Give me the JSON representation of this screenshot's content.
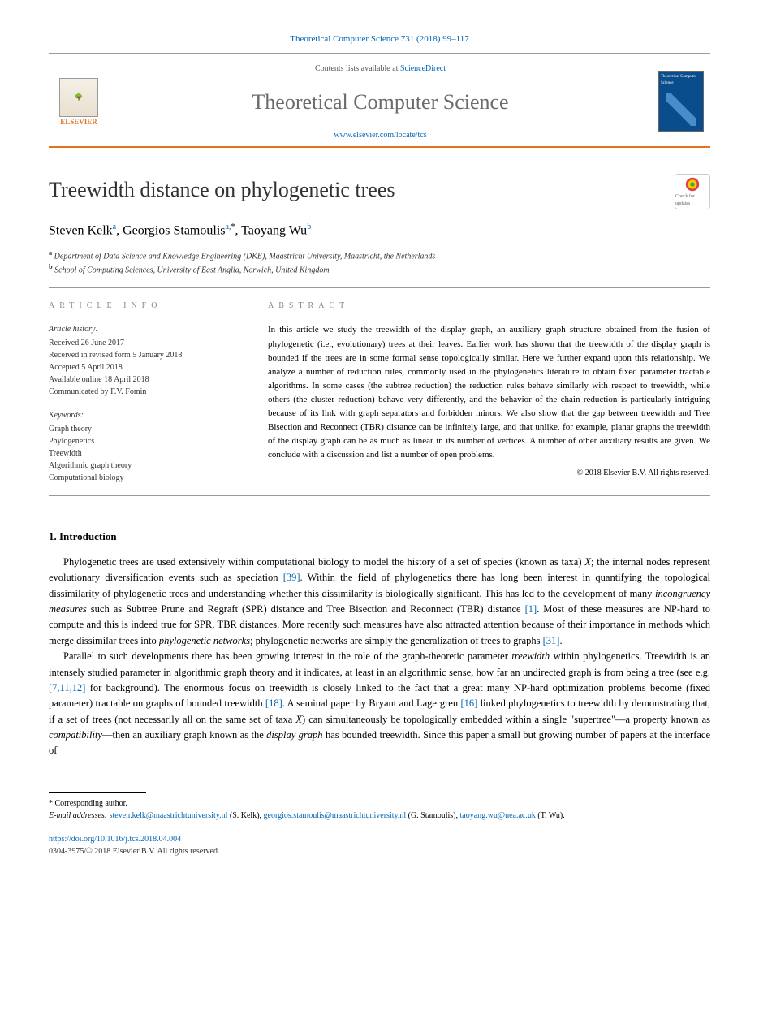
{
  "citation": "Theoretical Computer Science 731 (2018) 99–117",
  "header": {
    "contents_prefix": "Contents lists available at ",
    "contents_link": "ScienceDirect",
    "journal": "Theoretical Computer Science",
    "journal_url": "www.elsevier.com/locate/tcs",
    "publisher": "ELSEVIER",
    "cover_label": "Theoretical Computer Science"
  },
  "article": {
    "title": "Treewidth distance on phylogenetic trees",
    "check_badge": "Check for updates"
  },
  "authors": {
    "list": "Steven Kelk",
    "a1_sup": "a",
    "a2_name": ", Georgios Stamoulis",
    "a2_sup": "a,",
    "star": "*",
    "a3_name": ", Taoyang Wu",
    "a3_sup": "b"
  },
  "affiliations": {
    "a": "Department of Data Science and Knowledge Engineering (DKE), Maastricht University, Maastricht, the Netherlands",
    "b": "School of Computing Sciences, University of East Anglia, Norwich, United Kingdom"
  },
  "info": {
    "label": "ARTICLE INFO",
    "history_heading": "Article history:",
    "received": "Received 26 June 2017",
    "revised": "Received in revised form 5 January 2018",
    "accepted": "Accepted 5 April 2018",
    "online": "Available online 18 April 2018",
    "communicated": "Communicated by F.V. Fomin",
    "keywords_heading": "Keywords:",
    "keywords": [
      "Graph theory",
      "Phylogenetics",
      "Treewidth",
      "Algorithmic graph theory",
      "Computational biology"
    ]
  },
  "abstract": {
    "label": "ABSTRACT",
    "text": "In this article we study the treewidth of the display graph, an auxiliary graph structure obtained from the fusion of phylogenetic (i.e., evolutionary) trees at their leaves. Earlier work has shown that the treewidth of the display graph is bounded if the trees are in some formal sense topologically similar. Here we further expand upon this relationship. We analyze a number of reduction rules, commonly used in the phylogenetics literature to obtain fixed parameter tractable algorithms. In some cases (the subtree reduction) the reduction rules behave similarly with respect to treewidth, while others (the cluster reduction) behave very differently, and the behavior of the chain reduction is particularly intriguing because of its link with graph separators and forbidden minors. We also show that the gap between treewidth and Tree Bisection and Reconnect (TBR) distance can be infinitely large, and that unlike, for example, planar graphs the treewidth of the display graph can be as much as linear in its number of vertices. A number of other auxiliary results are given. We conclude with a discussion and list a number of open problems.",
    "copyright": "© 2018 Elsevier B.V. All rights reserved."
  },
  "intro": {
    "heading": "1. Introduction",
    "p1_a": "Phylogenetic trees are used extensively within computational biology to model the history of a set of species (known as taxa) ",
    "p1_b": "; the internal nodes represent evolutionary diversification events such as speciation ",
    "p1_c": ". Within the field of phylogenetics there has long been interest in quantifying the topological dissimilarity of phylogenetic trees and understanding whether this dissimilarity is biologically significant. This has led to the development of many ",
    "p1_d": " such as Subtree Prune and Regraft (SPR) distance and Tree Bisection and Reconnect (TBR) distance ",
    "p1_e": ". Most of these measures are NP-hard to compute and this is indeed true for SPR, TBR distances. More recently such measures have also attracted attention because of their importance in methods which merge dissimilar trees into ",
    "p1_f": "; phylogenetic networks are simply the generalization of trees to graphs ",
    "p1_g": ".",
    "p2_a": "Parallel to such developments there has been growing interest in the role of the graph-theoretic parameter ",
    "p2_b": " within phylogenetics. Treewidth is an intensely studied parameter in algorithmic graph theory and it indicates, at least in an algorithmic sense, how far an undirected graph is from being a tree (see e.g. ",
    "p2_c": " for background). The enormous focus on treewidth is closely linked to the fact that a great many NP-hard optimization problems become (fixed parameter) tractable on graphs of bounded treewidth ",
    "p2_d": ". A seminal paper by Bryant and Lagergren ",
    "p2_e": " linked phylogenetics to treewidth by demonstrating that, if a set of trees (not necessarily all on the same set of taxa ",
    "p2_f": ") can simultaneously be topologically embedded within a single \"supertree\"—a property known as ",
    "p2_g": "—then an auxiliary graph known as the ",
    "p2_h": " has bounded treewidth. Since this paper a small but growing number of papers at the interface of",
    "refs": {
      "r39": "[39]",
      "r1": "[1]",
      "r31": "[31]",
      "r71112": "[7,11,12]",
      "r18": "[18]",
      "r16": "[16]"
    },
    "italics": {
      "X": "X",
      "incongruency": "incongruency measures",
      "phylonet": "phylogenetic networks",
      "treewidth": "treewidth",
      "compatibility": "compatibility",
      "display": "display graph"
    }
  },
  "footnotes": {
    "corresponding": "Corresponding author.",
    "email_label": "E-mail addresses:",
    "emails": [
      {
        "addr": "steven.kelk@maastrichtuniversity.nl",
        "who": "(S. Kelk)"
      },
      {
        "addr": "georgios.stamoulis@maastrichtuniversity.nl",
        "who": "(G. Stamoulis)"
      },
      {
        "addr": "taoyang.wu@uea.ac.uk",
        "who": "(T. Wu)"
      }
    ]
  },
  "doi": {
    "url": "https://doi.org/10.1016/j.tcs.2018.04.004",
    "issn": "0304-3975/© 2018 Elsevier B.V. All rights reserved."
  }
}
